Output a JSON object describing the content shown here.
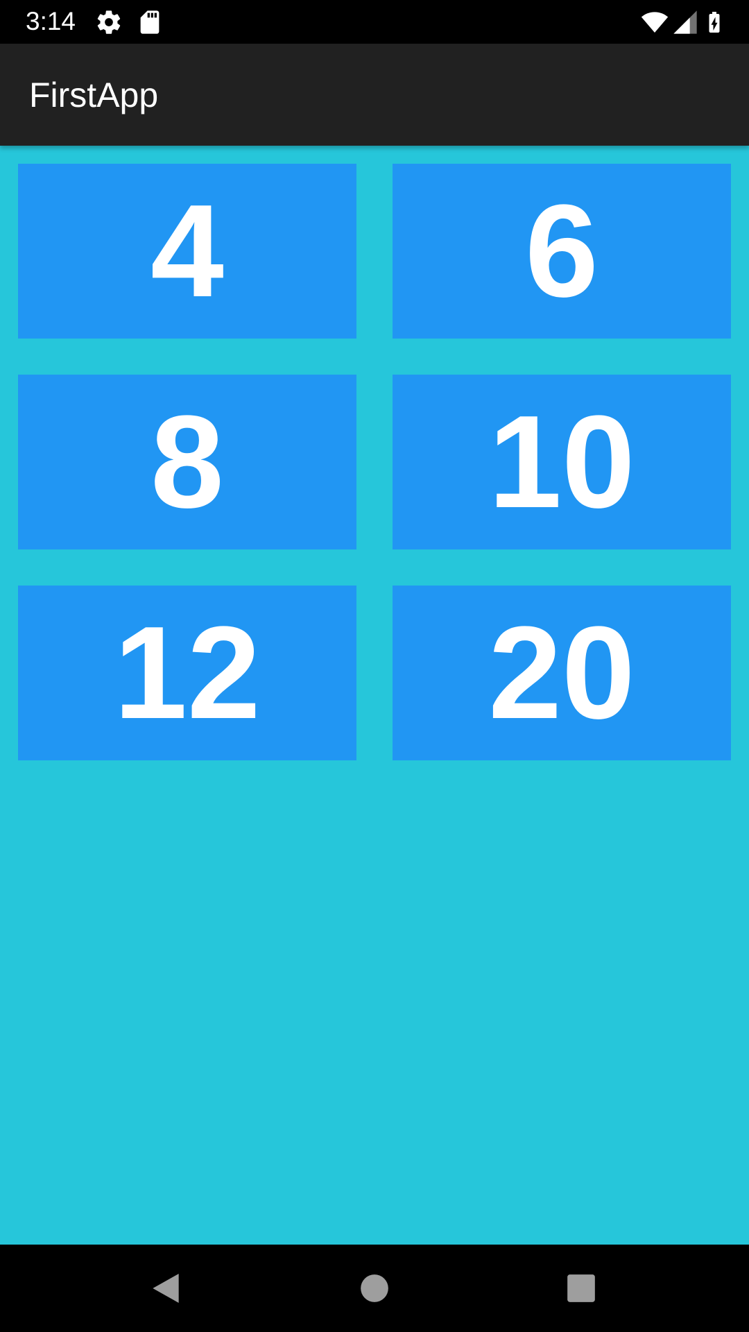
{
  "status_bar": {
    "time": "3:14",
    "icons": [
      "gear-icon",
      "sd-card-icon",
      "wifi-icon",
      "cell-signal-icon",
      "battery-charging-icon"
    ]
  },
  "app_bar": {
    "title": "FirstApp"
  },
  "tiles": [
    {
      "label": "4"
    },
    {
      "label": "6"
    },
    {
      "label": "8"
    },
    {
      "label": "10"
    },
    {
      "label": "12"
    },
    {
      "label": "20"
    }
  ],
  "navigation": {
    "buttons": [
      "back-icon",
      "home-icon",
      "recents-icon"
    ]
  },
  "colors": {
    "background": "#26c6da",
    "tile": "#2196f3",
    "app_bar": "#212121",
    "status_bar": "#000000",
    "text": "#ffffff",
    "nav_icon": "#9e9e9e"
  }
}
